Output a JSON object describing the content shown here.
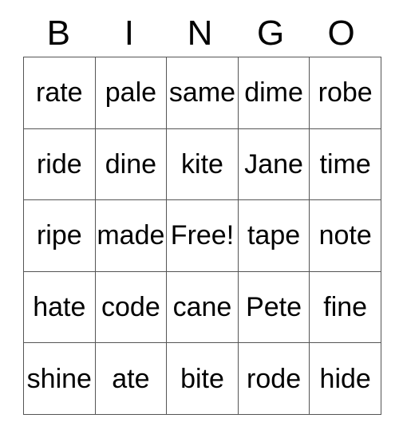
{
  "card": {
    "title": "BINGO",
    "header_letters": [
      "B",
      "I",
      "N",
      "G",
      "O"
    ],
    "columns": 5,
    "rows": 5,
    "free_space": "Free!",
    "free_space_position": {
      "row": 2,
      "col": 2
    },
    "colors": {
      "background": "#ffffff",
      "text": "#000000",
      "grid_line": "#555555"
    },
    "cells": [
      [
        "rate",
        "pale",
        "same",
        "dime",
        "robe"
      ],
      [
        "ride",
        "dine",
        "kite",
        "Jane",
        "time"
      ],
      [
        "ripe",
        "made",
        "Free!",
        "tape",
        "note"
      ],
      [
        "hate",
        "code",
        "cane",
        "Pete",
        "fine"
      ],
      [
        "shine",
        "ate",
        "bite",
        "rode",
        "hide"
      ]
    ]
  }
}
